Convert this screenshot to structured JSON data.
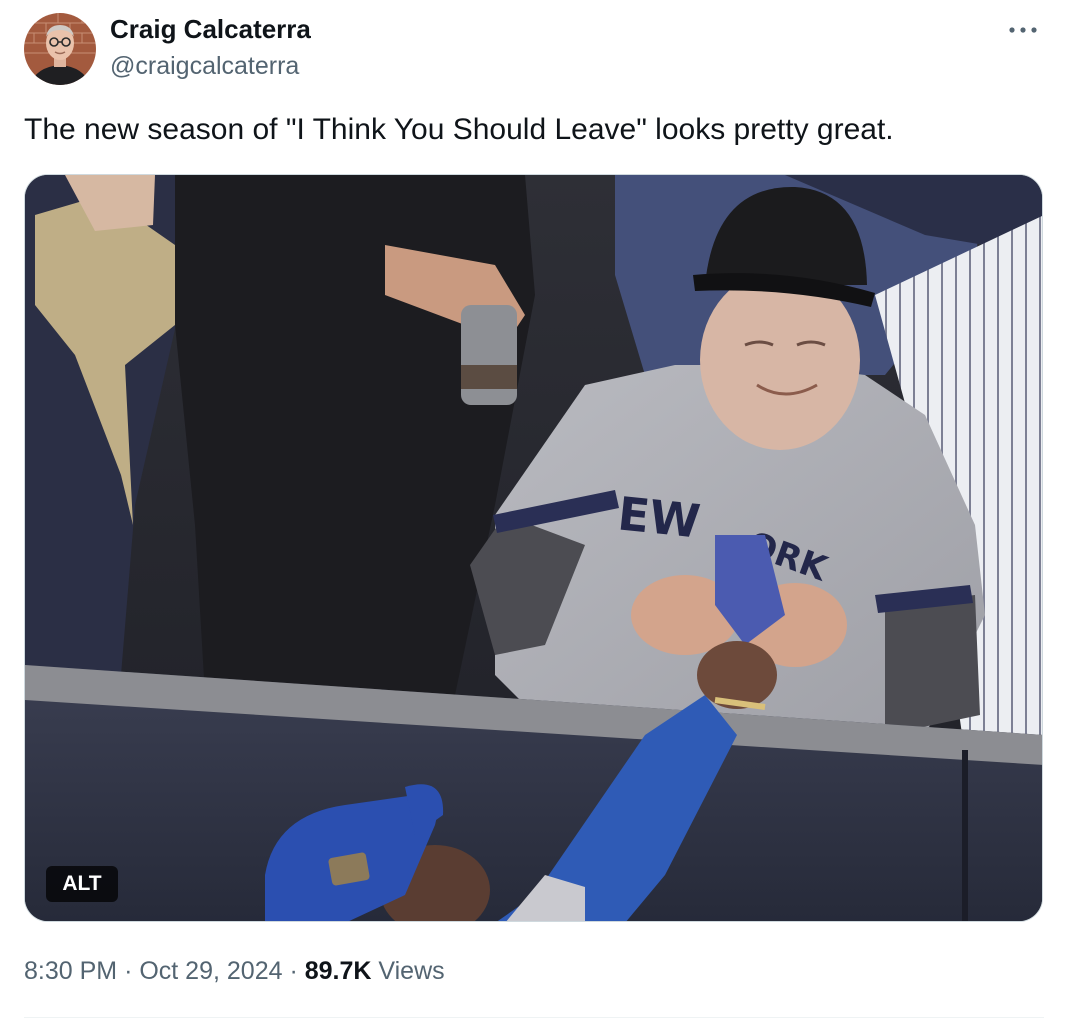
{
  "author": {
    "display_name": "Craig Calcaterra",
    "handle": "@craigcalcaterra",
    "avatar_icon": "user-avatar-photo"
  },
  "tweet": {
    "text": "The new season of \"I Think You Should Leave\" looks pretty great."
  },
  "media": {
    "alt_label": "ALT"
  },
  "meta": {
    "time": "8:30 PM",
    "separator": "·",
    "date": "Oct 29, 2024",
    "views_count": "89.7K",
    "views_label": "Views"
  },
  "icons": {
    "more": "more-horizontal-icon"
  },
  "colors": {
    "text_primary": "#0f1419",
    "text_secondary": "#536471",
    "background": "#ffffff"
  }
}
